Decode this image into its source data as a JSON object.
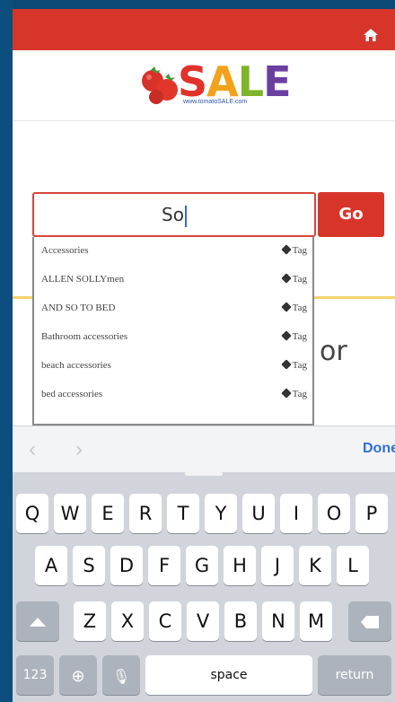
{
  "header": {
    "home_icon": "home-icon",
    "bar_color": "#d7352a"
  },
  "logo": {
    "word": "SALE",
    "url": "www.tomatoSALE.com",
    "letters": [
      {
        "ch": "S",
        "color": "#e0312a"
      },
      {
        "ch": "A",
        "color": "#f3a21b"
      },
      {
        "ch": "L",
        "color": "#7fb42b"
      },
      {
        "ch": "E",
        "color": "#6b3fa0"
      }
    ]
  },
  "search": {
    "value": "So",
    "go_label": "Go"
  },
  "suggestions": [
    {
      "label": "Accessories",
      "tag": "Tag"
    },
    {
      "label": "ALLEN SOLLYmen",
      "tag": "Tag"
    },
    {
      "label": "AND SO TO BED",
      "tag": "Tag"
    },
    {
      "label": "Bathroom accessories",
      "tag": "Tag"
    },
    {
      "label": "beach accessories",
      "tag": "Tag"
    },
    {
      "label": "bed accessories",
      "tag": "Tag"
    }
  ],
  "background_text": "or",
  "accessory_bar": {
    "prev_icon": "chevron-left-icon",
    "next_icon": "chevron-right-icon",
    "done_label": "Done"
  },
  "keyboard": {
    "row1": [
      "Q",
      "W",
      "E",
      "R",
      "T",
      "Y",
      "U",
      "I",
      "O",
      "P"
    ],
    "row2": [
      "A",
      "S",
      "D",
      "F",
      "G",
      "H",
      "J",
      "K",
      "L"
    ],
    "row3": [
      "Z",
      "X",
      "C",
      "V",
      "B",
      "N",
      "M"
    ],
    "numbers_label": "123",
    "space_label": "space",
    "return_label": "return"
  }
}
